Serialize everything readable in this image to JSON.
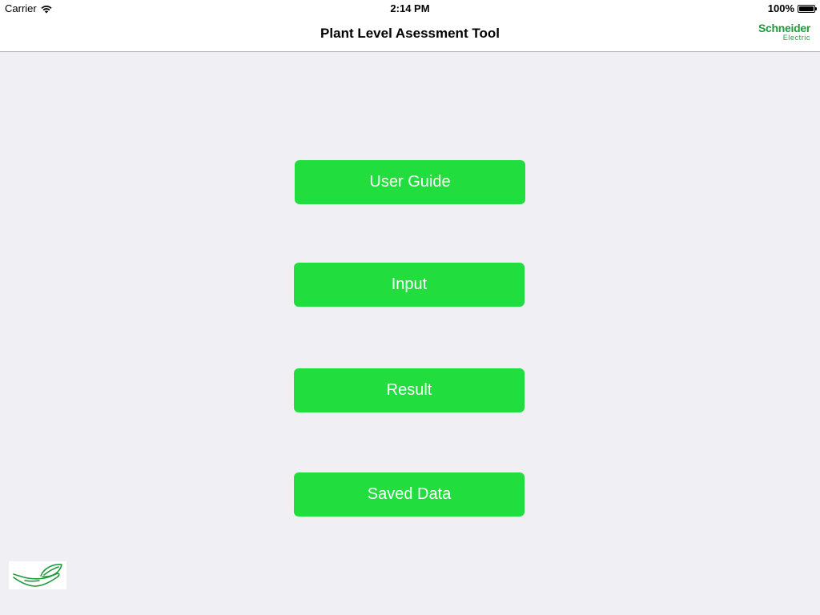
{
  "status_bar": {
    "carrier": "Carrier",
    "time": "2:14 PM",
    "battery_percent": "100%",
    "battery_level": 1.0,
    "wifi_icon": "wifi-icon",
    "battery_icon": "battery-icon"
  },
  "nav_bar": {
    "title": "Plant Level Asessment Tool",
    "brand_logo": {
      "top_text": "Schneider",
      "bottom_text": "Electric",
      "color": "#1e9a3a"
    }
  },
  "menu": {
    "buttons": [
      {
        "label": "User Guide"
      },
      {
        "label": "Input"
      },
      {
        "label": "Result"
      },
      {
        "label": "Saved Data"
      }
    ],
    "button_color": "#21dd3e",
    "button_text_color": "#ffffff"
  },
  "footer": {
    "logo_icon": "hand-leaf-icon",
    "logo_color": "#1e9a3a"
  },
  "colors": {
    "background": "#efeff4",
    "bar_background": "#ffffff"
  }
}
